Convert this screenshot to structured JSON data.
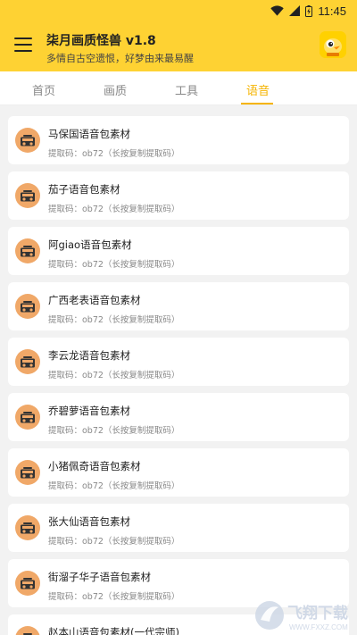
{
  "status_bar": {
    "time": "11:45"
  },
  "header": {
    "title": "柒月画质怪兽 v1.8",
    "subtitle": "多情自古空遗恨，好梦由来最易醒"
  },
  "tabs": [
    {
      "label": "首页",
      "active": false
    },
    {
      "label": "画质",
      "active": false
    },
    {
      "label": "工具",
      "active": false
    },
    {
      "label": "语音",
      "active": true
    }
  ],
  "items": [
    {
      "title": "马保国语音包素材",
      "code": "提取码：ob72（长按复制提取码）"
    },
    {
      "title": "茄子语音包素材",
      "code": "提取码：ob72（长按复制提取码）"
    },
    {
      "title": "阿giao语音包素材",
      "code": "提取码：ob72（长按复制提取码）"
    },
    {
      "title": "广西老表语音包素材",
      "code": "提取码：ob72（长按复制提取码）"
    },
    {
      "title": "李云龙语音包素材",
      "code": "提取码：ob72（长按复制提取码）"
    },
    {
      "title": "乔碧萝语音包素材",
      "code": "提取码：ob72（长按复制提取码）"
    },
    {
      "title": "小猪佩奇语音包素材",
      "code": "提取码：ob72（长按复制提取码）"
    },
    {
      "title": "张大仙语音包素材",
      "code": "提取码：ob72（长按复制提取码）"
    },
    {
      "title": "街溜子华子语音包素材",
      "code": "提取码：ob72（长按复制提取码）"
    },
    {
      "title": "赵本山语音包素材(一代宗师)",
      "code": ""
    }
  ],
  "watermark": {
    "text": "飞翔下载",
    "url_text": "WWW.FXXZ.COM"
  },
  "colors": {
    "accent": "#fed233",
    "active_tab": "#f5b400",
    "icon_bg": "#f0a868"
  }
}
